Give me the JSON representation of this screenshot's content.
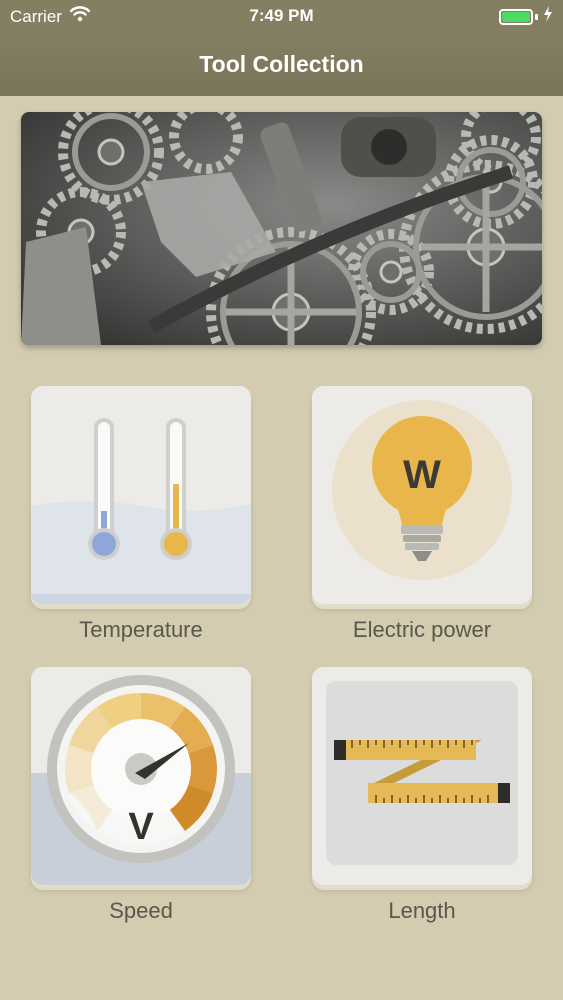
{
  "status_bar": {
    "carrier": "Carrier",
    "time": "7:49 PM",
    "wifi_icon": "wifi-icon",
    "battery_icon": "battery-icon",
    "charging_icon": "charging-bolt-icon"
  },
  "nav": {
    "title": "Tool Collection"
  },
  "hero": {
    "image": "gears-and-tools-photo"
  },
  "tools": [
    {
      "label": "Temperature",
      "icon": "thermometer-icon"
    },
    {
      "label": "Electric power",
      "icon": "lightbulb-icon",
      "icon_text": "W"
    },
    {
      "label": "Speed",
      "icon": "speedometer-icon",
      "icon_text": "V"
    },
    {
      "label": "Length",
      "icon": "measuring-tape-icon"
    }
  ],
  "colors": {
    "background": "#d3ccb1",
    "nav_bar": "#847e63",
    "tile": "#ebeae6",
    "label_text": "#5b574a",
    "accent_gold": "#e8b64a",
    "accent_blue": "#8fa6dc",
    "battery_green": "#4cd964"
  }
}
